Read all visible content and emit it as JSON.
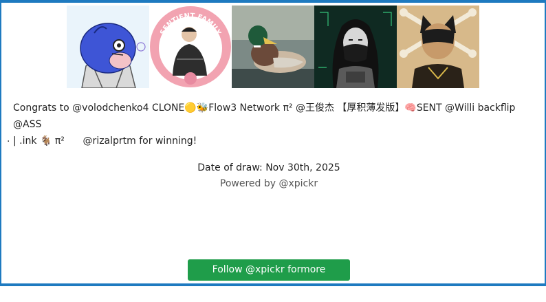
{
  "avatars": [
    {
      "name": "blue-bird-avatar"
    },
    {
      "name": "sentient-family-avatar",
      "badge_text": "SENTIENT FAMILY"
    },
    {
      "name": "duck-avatar"
    },
    {
      "name": "masked-woman-avatar"
    },
    {
      "name": "cat-mask-pirate-avatar"
    }
  ],
  "congrats": {
    "line1": "Congrats to @volodchenko4 CLONE🟡🐝Flow3 Network π² @王俊杰 【厚积薄发版】🧠SENT @Willi backflip @ASS",
    "line2": "| .ink 🐐 π²      @rizalprtm for winning!"
  },
  "stray_dot": ".",
  "date_of_draw": "Date of draw: Nov 30th, 2025",
  "powered_by": "Powered by @xpickr",
  "follow_button": "Follow @xpickr formore giveaways",
  "colors": {
    "frame": "#1e7ac0",
    "button": "#1f9d4a"
  }
}
